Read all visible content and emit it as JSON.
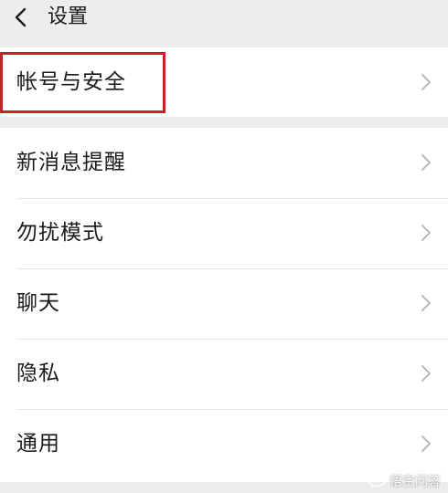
{
  "header": {
    "title": "设置",
    "back_icon": "chevron-left-icon"
  },
  "account_group": {
    "items": [
      {
        "label": "帐号与安全",
        "icon": "chevron-right-icon"
      }
    ]
  },
  "main_group": {
    "items": [
      {
        "label": "新消息提醒",
        "icon": "chevron-right-icon"
      },
      {
        "label": "勿扰模式",
        "icon": "chevron-right-icon"
      },
      {
        "label": "聊天",
        "icon": "chevron-right-icon"
      },
      {
        "label": "隐私",
        "icon": "chevron-right-icon"
      },
      {
        "label": "通用",
        "icon": "chevron-right-icon"
      }
    ]
  },
  "watermark": {
    "text": "悟空问答"
  },
  "colors": {
    "highlight": "#c9212a",
    "background": "#ececec",
    "row_background": "#ffffff",
    "chevron": "#b2b2b2"
  }
}
